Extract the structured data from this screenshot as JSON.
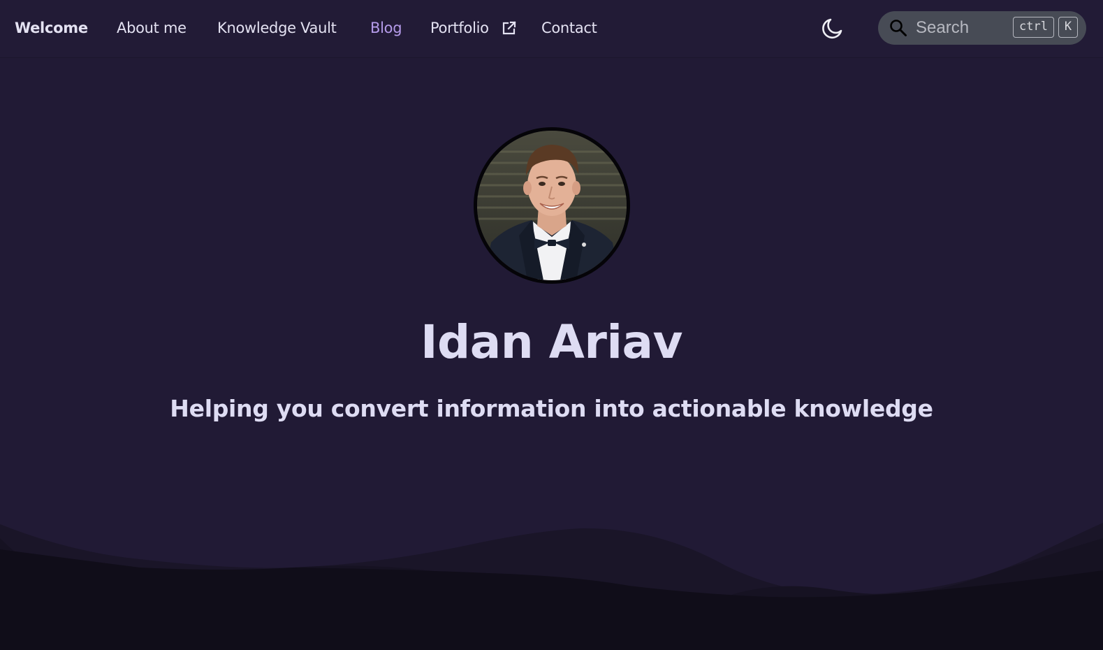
{
  "nav": {
    "brand": "Welcome",
    "about": "About me",
    "vault": "Knowledge Vault",
    "blog": "Blog",
    "portfolio": "Portfolio",
    "contact": "Contact",
    "active_color": "#b59bea"
  },
  "search": {
    "placeholder": "Search",
    "shortcut_modifier": "ctrl",
    "shortcut_key": "K"
  },
  "hero": {
    "name": "Idan Ariav",
    "tagline": "Helping you convert information into actionable knowledge"
  },
  "icons": {
    "theme": "moon-icon",
    "search": "search-icon",
    "external": "external-link-icon"
  },
  "colors": {
    "background": "#211a35",
    "text": "#dedcf3",
    "search_bg": "#474b55"
  }
}
